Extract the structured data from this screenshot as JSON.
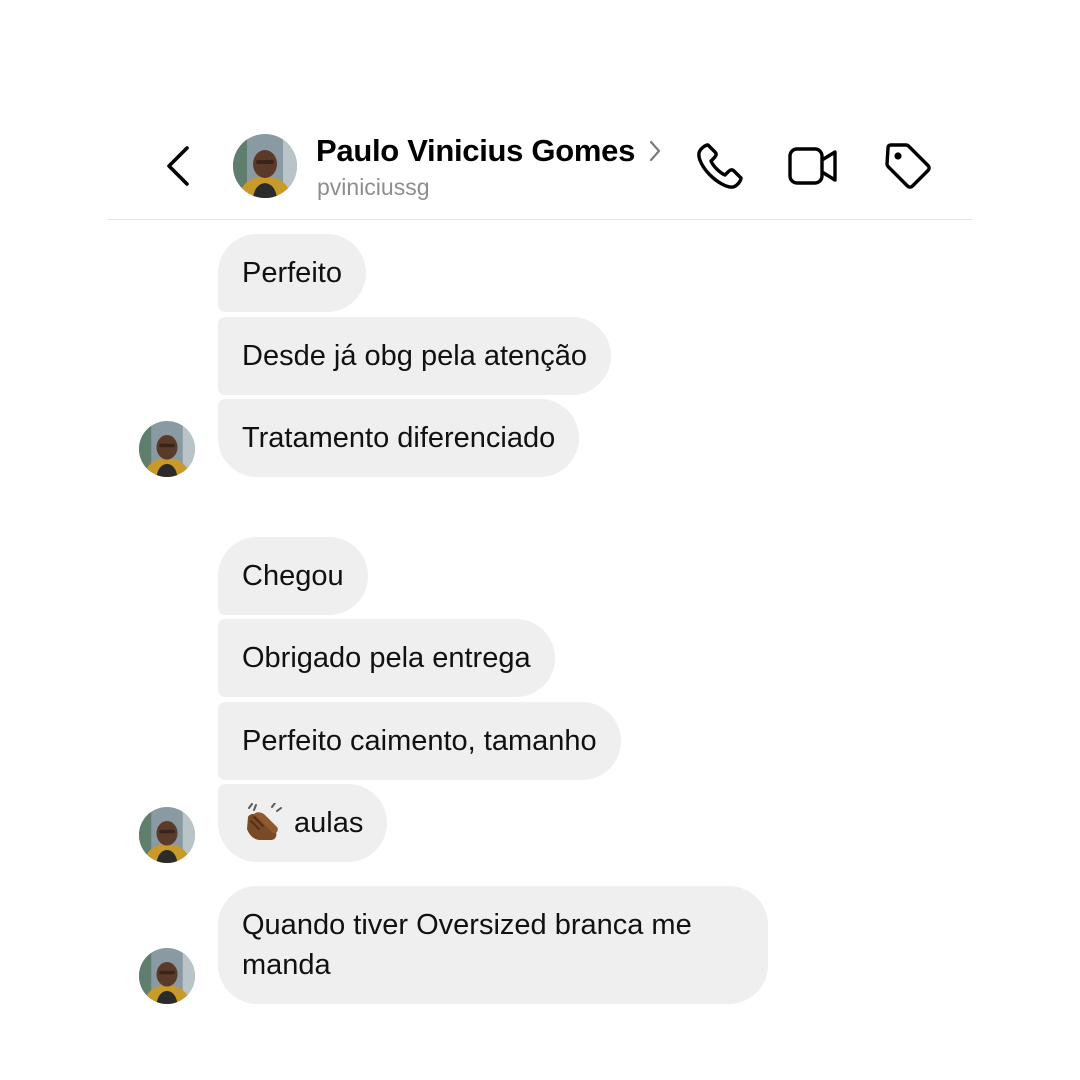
{
  "header": {
    "name": "Paulo Vinicius Gomes",
    "username": "pviniciussg"
  },
  "icons": {
    "back": "chevron-left-icon",
    "name_chevron": "chevron-right-icon",
    "call": "phone-icon",
    "video": "video-camera-icon",
    "tag": "tag-icon",
    "reaction": "clapping-hands-emoji"
  },
  "messages": [
    {
      "text": "Perfeito"
    },
    {
      "text": "Desde já obg pela atenção"
    },
    {
      "text": "Tratamento diferenciado"
    },
    {
      "text": "Chegou"
    },
    {
      "text": "Obrigado pela entrega"
    },
    {
      "text": "Perfeito caimento, tamanho"
    },
    {
      "emoji": "👏🏾",
      "text": "aulas"
    },
    {
      "text": "Quando tiver Oversized branca me manda"
    }
  ],
  "colors": {
    "bubble": "#efefef",
    "username": "#8e8e8e",
    "divider": "#e4e4e4"
  }
}
